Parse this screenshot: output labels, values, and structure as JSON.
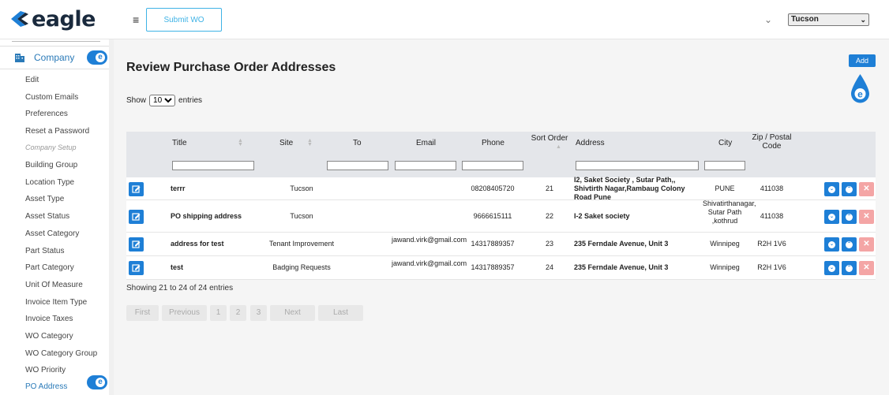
{
  "header": {
    "logo_text": "eagle",
    "submit_wo_label": "Submit WO",
    "site_select_value": "Tucson"
  },
  "sidebar": {
    "company_label": "Company",
    "badge_letter": "e",
    "items": [
      {
        "label": "Edit",
        "style": "normal"
      },
      {
        "label": "Custom Emails",
        "style": "normal"
      },
      {
        "label": "Preferences",
        "style": "normal"
      },
      {
        "label": "Reset a Password",
        "style": "normal"
      },
      {
        "label": "Company Setup",
        "style": "dim"
      },
      {
        "label": "Building Group",
        "style": "normal"
      },
      {
        "label": "Location Type",
        "style": "normal"
      },
      {
        "label": "Asset Type",
        "style": "normal"
      },
      {
        "label": "Asset Status",
        "style": "normal"
      },
      {
        "label": "Asset Category",
        "style": "normal"
      },
      {
        "label": "Part Status",
        "style": "normal"
      },
      {
        "label": "Part Category",
        "style": "normal"
      },
      {
        "label": "Unit Of Measure",
        "style": "normal"
      },
      {
        "label": "Invoice Item Type",
        "style": "normal"
      },
      {
        "label": "Invoice Taxes",
        "style": "normal"
      },
      {
        "label": "WO Category",
        "style": "normal"
      },
      {
        "label": "WO Category Group",
        "style": "normal"
      },
      {
        "label": "WO Priority",
        "style": "normal"
      },
      {
        "label": "PO Address",
        "style": "active"
      }
    ]
  },
  "main": {
    "title": "Review Purchase Order Addresses",
    "add_label": "Add",
    "show_label": "Show",
    "entries_value": "10",
    "entries_label": "entries",
    "showing_text": "Showing 21 to 24 of 24 entries"
  },
  "table": {
    "headers": {
      "title": "Title",
      "site": "Site",
      "to": "To",
      "email": "Email",
      "phone": "Phone",
      "sort_order": "Sort Order",
      "address": "Address",
      "city": "City",
      "zip": "Zip / Postal Code"
    },
    "rows": [
      {
        "title": "terrr",
        "site": "Tucson",
        "email": "",
        "phone": "08208405720",
        "sort_order": "21",
        "address": "I2, Saket Society , Sutar Path,, Shivtirth Nagar,Rambaug Colony Road Pune",
        "city": "PUNE",
        "zip": "411038"
      },
      {
        "title": "PO shipping address",
        "site": "Tucson",
        "email": "",
        "phone": "9666615111",
        "sort_order": "22",
        "address": "I-2 Saket society",
        "city": "Shivatirthanagar, Sutar Path ,kothrud",
        "zip": "411038"
      },
      {
        "title": "address for test",
        "site": "Tenant Improvement",
        "email": "jawand.virk@gmail.com",
        "phone": "14317889357",
        "sort_order": "23",
        "address": "235 Ferndale Avenue, Unit 3",
        "city": "Winnipeg",
        "zip": "R2H 1V6"
      },
      {
        "title": "test",
        "site": "Badging Requests",
        "email": "jawand.virk@gmail.com",
        "phone": "14317889357",
        "sort_order": "24",
        "address": "235 Ferndale Avenue, Unit 3",
        "city": "Winnipeg",
        "zip": "R2H 1V6"
      }
    ]
  },
  "pagination": {
    "first": "First",
    "previous": "Previous",
    "pages": [
      "1",
      "2",
      "3"
    ],
    "next": "Next",
    "last": "Last"
  },
  "colors": {
    "accent": "#1e7fd6",
    "delete": "#f4a5a5",
    "sidebar_active": "#2a7ab8"
  }
}
